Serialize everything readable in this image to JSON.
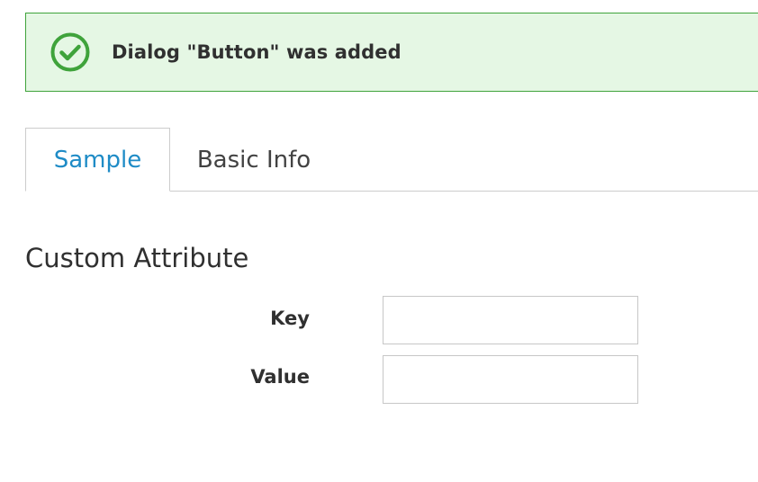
{
  "notification": {
    "message": "Dialog \"Button\" was added",
    "icon": "check-circle-icon",
    "accent_color": "#3fa33b",
    "background_color": "#e5f7e4"
  },
  "tabs": [
    {
      "label": "Sample",
      "active": true
    },
    {
      "label": "Basic Info",
      "active": false
    }
  ],
  "section": {
    "title": "Custom Attribute",
    "fields": [
      {
        "label": "Key",
        "value": ""
      },
      {
        "label": "Value",
        "value": ""
      }
    ]
  },
  "colors": {
    "tab_active_text": "#1e8bc6",
    "border": "#cccccc"
  }
}
